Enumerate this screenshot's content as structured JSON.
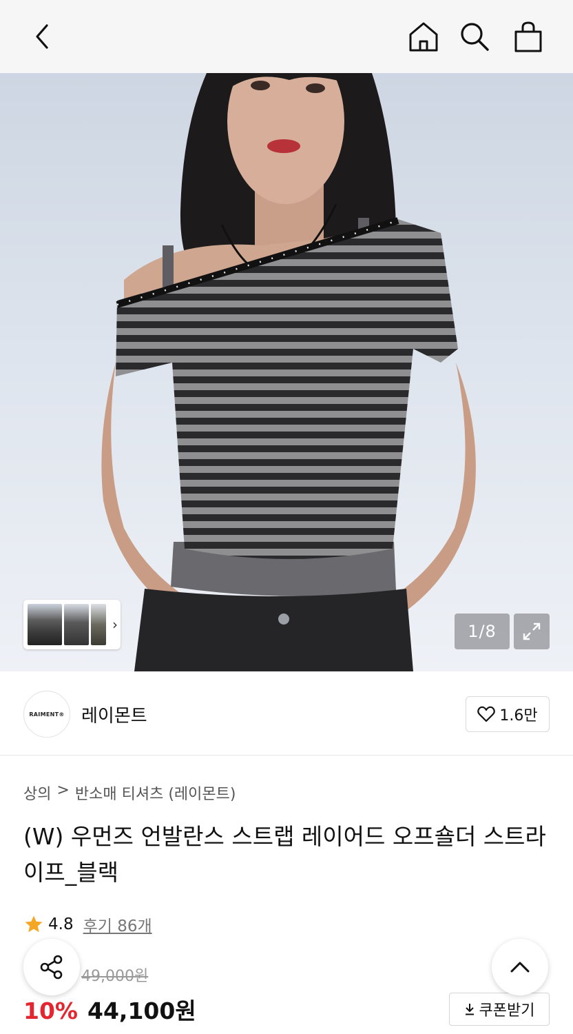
{
  "header": {
    "back_icon": "chevron-left-icon",
    "home_icon": "home-icon",
    "search_icon": "search-icon",
    "bag_icon": "shopping-bag-icon"
  },
  "gallery": {
    "counter": "1/8",
    "expand_icon": "expand-icon",
    "thumb_more_icon": "chevron-right-icon"
  },
  "brand": {
    "logo_text": "RAIMENT®",
    "name": "레이몬트",
    "likes": "1.6만",
    "like_icon": "heart-icon"
  },
  "breadcrumb": {
    "category": "상의",
    "separator": ">",
    "subcategory": "반소매 티셔츠 (레이몬트)"
  },
  "product": {
    "title": "(W) 우먼즈 언발란스 스트랩 레이어드 오프숄더 스트라이프_블랙",
    "rating": "4.8",
    "reviews": "후기 86개",
    "original_price": "49,000원",
    "discount": "10%",
    "price": "44,100원",
    "coupon_label": "쿠폰받기"
  },
  "colors": {
    "discount": "#e3262f",
    "star": "#f5a623"
  }
}
